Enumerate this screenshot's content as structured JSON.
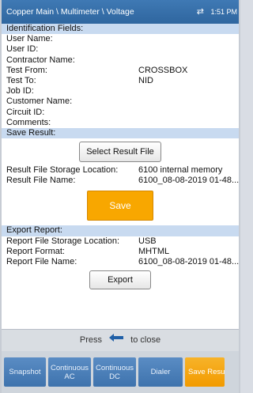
{
  "titlebar": {
    "path": "Copper Main \\ Multimeter \\ Voltage",
    "time": "1:51 PM"
  },
  "identification": {
    "header": "Identification Fields:",
    "fields": [
      {
        "label": "User Name:",
        "value": ""
      },
      {
        "label": "User ID:",
        "value": ""
      },
      {
        "label": "Contractor Name:",
        "value": ""
      },
      {
        "label": "Test From:",
        "value": "CROSSBOX"
      },
      {
        "label": "Test To:",
        "value": "NID"
      },
      {
        "label": "Job ID:",
        "value": ""
      },
      {
        "label": "Customer Name:",
        "value": ""
      },
      {
        "label": "Circuit ID:",
        "value": ""
      },
      {
        "label": "Comments:",
        "value": ""
      }
    ]
  },
  "save_result": {
    "header": "Save Result:",
    "select_button": "Select Result File",
    "storage_label": "Result File Storage Location:",
    "storage_value": "6100 internal memory",
    "filename_label": "Result File Name:",
    "filename_value": "6100_08-08-2019 01-48...",
    "save_button": "Save"
  },
  "export_report": {
    "header": "Export Report:",
    "storage_label": "Report File Storage Location:",
    "storage_value": "USB",
    "format_label": "Report Format:",
    "format_value": "MHTML",
    "filename_label": "Report File Name:",
    "filename_value": "6100_08-08-2019 01-48...",
    "export_button": "Export"
  },
  "closebar": {
    "prefix": "Press",
    "suffix": "to close"
  },
  "softkeys": [
    {
      "label": "Snapshot"
    },
    {
      "label": "Continuous\nAC"
    },
    {
      "label": "Continuous\nDC"
    },
    {
      "label": "Dialer"
    },
    {
      "label": "Save Resu"
    }
  ],
  "colors": {
    "accent": "#3b71ad",
    "save": "#f8a700",
    "section_bg": "#c8daf0"
  }
}
